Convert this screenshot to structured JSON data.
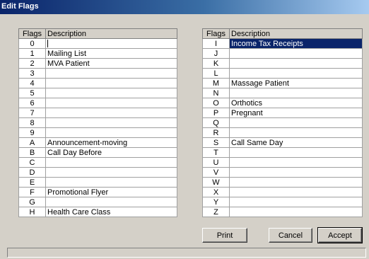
{
  "window": {
    "title": "Edit Flags"
  },
  "columns": {
    "flags": "Flags",
    "description": "Description"
  },
  "left_rows": [
    {
      "flag": "0",
      "desc": ""
    },
    {
      "flag": "1",
      "desc": "Mailing List"
    },
    {
      "flag": "2",
      "desc": "MVA Patient"
    },
    {
      "flag": "3",
      "desc": ""
    },
    {
      "flag": "4",
      "desc": ""
    },
    {
      "flag": "5",
      "desc": ""
    },
    {
      "flag": "6",
      "desc": ""
    },
    {
      "flag": "7",
      "desc": ""
    },
    {
      "flag": "8",
      "desc": ""
    },
    {
      "flag": "9",
      "desc": ""
    },
    {
      "flag": "A",
      "desc": "Announcement-moving"
    },
    {
      "flag": "B",
      "desc": "Call Day Before"
    },
    {
      "flag": "C",
      "desc": ""
    },
    {
      "flag": "D",
      "desc": ""
    },
    {
      "flag": "E",
      "desc": ""
    },
    {
      "flag": "F",
      "desc": "Promotional Flyer"
    },
    {
      "flag": "G",
      "desc": ""
    },
    {
      "flag": "H",
      "desc": "Health Care Class"
    }
  ],
  "right_rows": [
    {
      "flag": "I",
      "desc": "Income Tax Receipts",
      "selected": true
    },
    {
      "flag": "J",
      "desc": ""
    },
    {
      "flag": "K",
      "desc": ""
    },
    {
      "flag": "L",
      "desc": ""
    },
    {
      "flag": "M",
      "desc": "Massage Patient"
    },
    {
      "flag": "N",
      "desc": ""
    },
    {
      "flag": "O",
      "desc": "Orthotics"
    },
    {
      "flag": "P",
      "desc": "Pregnant"
    },
    {
      "flag": "Q",
      "desc": ""
    },
    {
      "flag": "R",
      "desc": ""
    },
    {
      "flag": "S",
      "desc": "Call Same Day"
    },
    {
      "flag": "T",
      "desc": ""
    },
    {
      "flag": "U",
      "desc": ""
    },
    {
      "flag": "V",
      "desc": ""
    },
    {
      "flag": "W",
      "desc": ""
    },
    {
      "flag": "X",
      "desc": ""
    },
    {
      "flag": "Y",
      "desc": ""
    },
    {
      "flag": "Z",
      "desc": ""
    }
  ],
  "buttons": {
    "print": "Print",
    "cancel": "Cancel",
    "accept": "Accept"
  },
  "colors": {
    "selection": "#0a246a",
    "face": "#d4d0c8"
  }
}
